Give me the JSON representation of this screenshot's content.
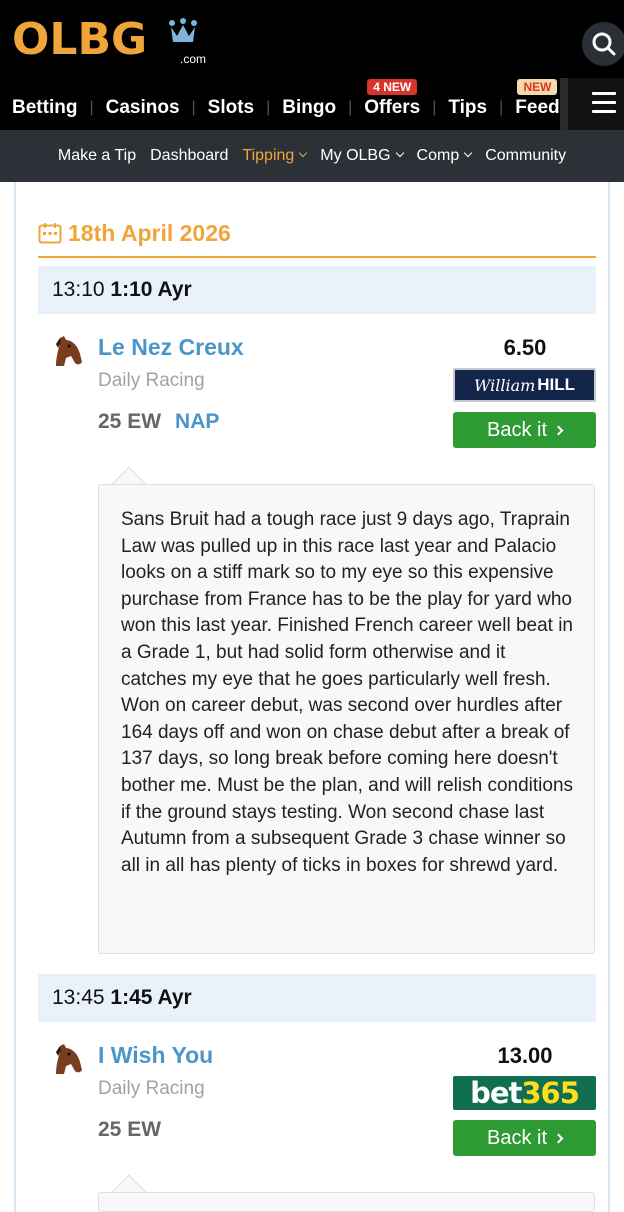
{
  "brand": {
    "logo_text": "OLBG",
    "logo_suffix": ".com",
    "accent": "#f0a53a"
  },
  "main_nav": [
    {
      "label": "Betting"
    },
    {
      "label": "Casinos"
    },
    {
      "label": "Slots"
    },
    {
      "label": "Bingo"
    },
    {
      "label": "Offers",
      "badge": "4 NEW"
    },
    {
      "label": "Tips"
    },
    {
      "label": "Feed",
      "badge": "NEW"
    }
  ],
  "sub_nav": {
    "make_tip": "Make a Tip",
    "dashboard": "Dashboard",
    "tipping": "Tipping",
    "my_olbg": "My OLBG",
    "comp": "Comp",
    "community": "Community"
  },
  "date": "18th April 2026",
  "races": [
    {
      "time": "13:10",
      "race": "1:10 Ayr",
      "horse": "Le Nez Creux",
      "source": "Daily Racing",
      "stake": "25 EW",
      "tag": "NAP",
      "odds": "6.50",
      "bookmaker": "William HILL",
      "bookmaker_a": "William",
      "bookmaker_b": "HILL",
      "back_label": "Back it",
      "comment": "Sans Bruit had a tough race just 9 days ago, Traprain Law was pulled up in this race last year and Palacio looks on a stiff mark so to my eye so this expensive purchase from France has to be the play for yard who won this last year. Finished French career well beat in a Grade 1, but had solid form otherwise and it catches my eye that he goes particularly well fresh. Won on career debut, was second over hurdles after 164 days off and won on chase debut after a break of 137 days, so long break before coming here doesn't bother me. Must be the plan, and will relish conditions if the ground stays testing. Won second chase last Autumn from a subsequent Grade 3 chase winner so all in all has plenty of ticks in boxes for shrewd yard."
    },
    {
      "time": "13:45",
      "race": "1:45 Ayr",
      "horse": "I Wish You",
      "source": "Daily Racing",
      "stake": "25 EW",
      "odds": "13.00",
      "bookmaker": "bet365",
      "bookmaker_a": "bet",
      "bookmaker_b": "365",
      "back_label": "Back it"
    }
  ]
}
